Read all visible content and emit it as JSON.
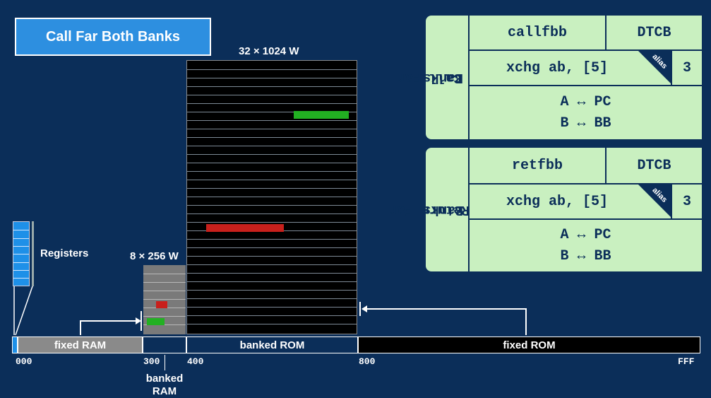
{
  "title": "Call Far Both Banks",
  "rom_size_label": "32 × 1024 W",
  "bram_size_label": "8 × 256 W",
  "registers_label": "Registers",
  "memory_map": {
    "fixed_ram": "fixed RAM",
    "banked_rom": "banked ROM",
    "fixed_rom": "fixed ROM",
    "banked_ram": "banked\nRAM"
  },
  "addresses": [
    "000",
    "300",
    "400",
    "800",
    "FFF"
  ],
  "colors": {
    "accent": "#2d8fe0",
    "green": "#22b022",
    "red": "#c8201c",
    "panel": "#c9f0c0",
    "background": "#0b2e59"
  },
  "panels": [
    {
      "label_line1": "Call Far",
      "label_line2": "Both Banks",
      "mnemonic": "callfbb",
      "opcode": "DTCB",
      "alias_text": "alias",
      "alias_instr": "xchg ab, [5]",
      "cycles": "3",
      "swap1": "A ↔ PC",
      "swap2": "B ↔ BB"
    },
    {
      "label_line1": "Return Far",
      "label_line2": "Both Banks",
      "mnemonic": "retfbb",
      "opcode": "DTCB",
      "alias_text": "alias",
      "alias_instr": "xchg ab, [5]",
      "cycles": "3",
      "swap1": "A ↔ PC",
      "swap2": "B ↔ BB"
    }
  ]
}
